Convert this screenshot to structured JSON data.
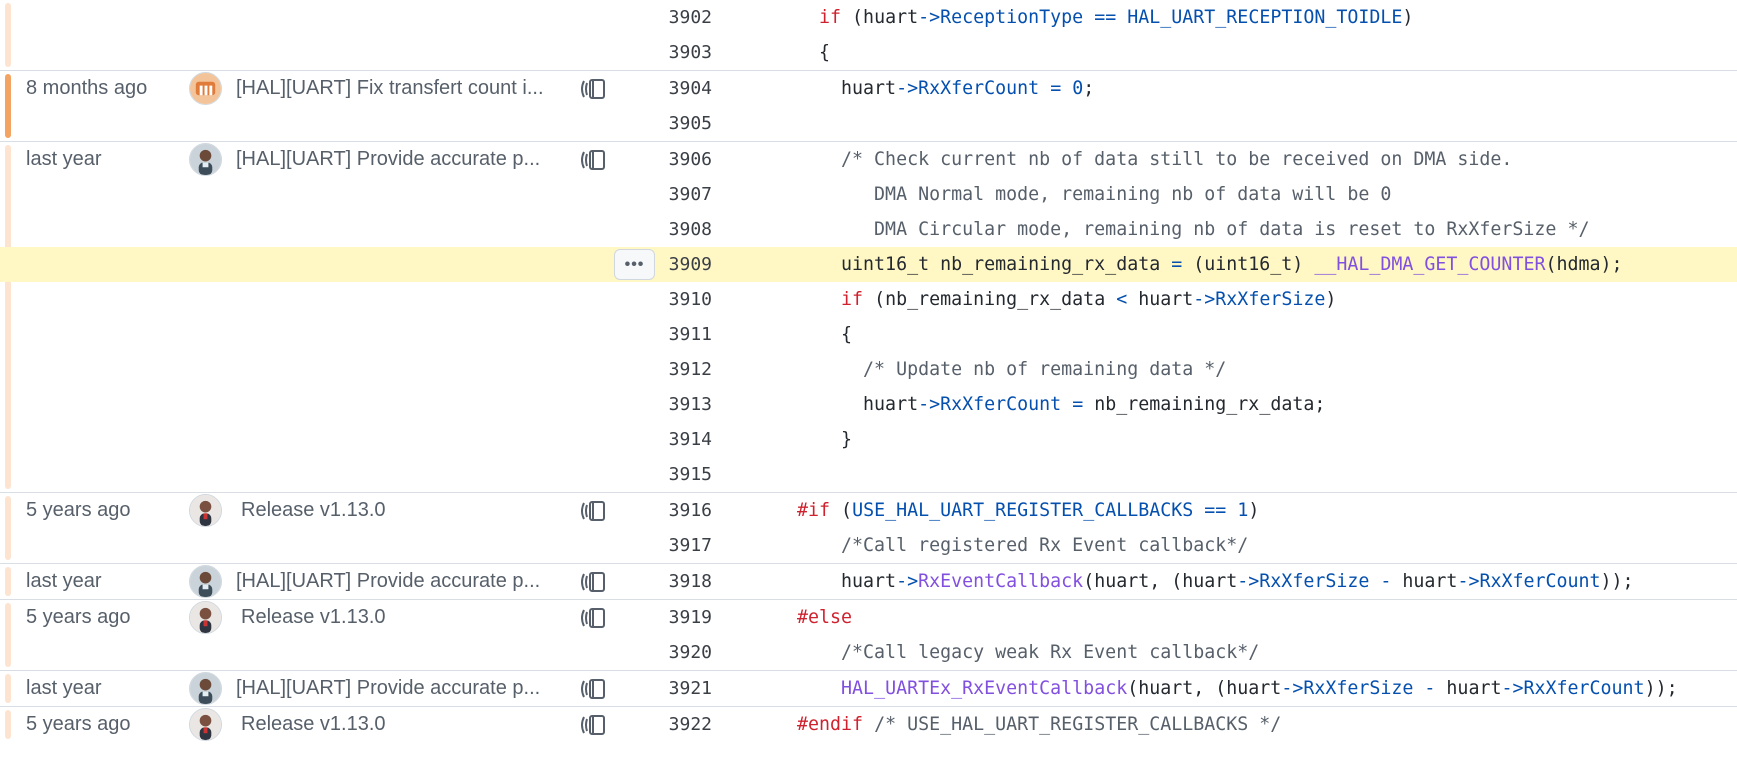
{
  "colors": {
    "heat_recent": "#f4a462",
    "heat_old": "#fde4d1",
    "highlight": "#fff8c5"
  },
  "line_menu": {
    "label": "•••",
    "icon": "kebab-horizontal-icon"
  },
  "hunks": [
    {
      "heat": "old",
      "age": "",
      "message": "",
      "avatar": "none",
      "lines": [
        {
          "num": "3902",
          "code": [
            [
              "",
              "    "
            ],
            [
              "k",
              "if"
            ],
            [
              "",
              " (huart"
            ],
            [
              "p",
              "->"
            ],
            [
              "n",
              "ReceptionType"
            ],
            [
              "",
              " "
            ],
            [
              "p",
              "=="
            ],
            [
              "",
              " "
            ],
            [
              "n",
              "HAL_UART_RECEPTION_TOIDLE"
            ],
            [
              "",
              ")"
            ]
          ]
        },
        {
          "num": "3903",
          "code": [
            [
              "",
              "    {"
            ]
          ]
        }
      ]
    },
    {
      "heat": "recent",
      "age": "8 months ago",
      "message": "[HAL][UART] Fix transfert count i...",
      "avatar": "orange-logo",
      "lines": [
        {
          "num": "3904",
          "code": [
            [
              "",
              "      huart"
            ],
            [
              "p",
              "->"
            ],
            [
              "n",
              "RxXferCount"
            ],
            [
              "",
              " "
            ],
            [
              "p",
              "="
            ],
            [
              "",
              " "
            ],
            [
              "n",
              "0"
            ],
            [
              "",
              ";"
            ]
          ]
        },
        {
          "num": "3905",
          "code": [
            [
              "",
              ""
            ]
          ]
        }
      ]
    },
    {
      "heat": "old",
      "age": "last year",
      "message": "[HAL][UART] Provide accurate p...",
      "avatar": "person-a",
      "lines": [
        {
          "num": "3906",
          "code": [
            [
              "c",
              "      /* Check current nb of data still to be received on DMA side."
            ]
          ]
        },
        {
          "num": "3907",
          "code": [
            [
              "c",
              "         DMA Normal mode, remaining nb of data will be 0"
            ]
          ]
        },
        {
          "num": "3908",
          "code": [
            [
              "c",
              "         DMA Circular mode, remaining nb of data is reset to RxXferSize */"
            ]
          ]
        },
        {
          "num": "3909",
          "highlight": true,
          "code": [
            [
              "",
              "      uint16_t nb_remaining_rx_data "
            ],
            [
              "p",
              "="
            ],
            [
              "",
              " (uint16_t) "
            ],
            [
              "f",
              "__HAL_DMA_GET_COUNTER"
            ],
            [
              "",
              "(hdma);"
            ]
          ]
        },
        {
          "num": "3910",
          "code": [
            [
              "",
              "      "
            ],
            [
              "k",
              "if"
            ],
            [
              "",
              " (nb_remaining_rx_data "
            ],
            [
              "p",
              "<"
            ],
            [
              "",
              " huart"
            ],
            [
              "p",
              "->"
            ],
            [
              "n",
              "RxXferSize"
            ],
            [
              "",
              ")"
            ]
          ]
        },
        {
          "num": "3911",
          "code": [
            [
              "",
              "      {"
            ]
          ]
        },
        {
          "num": "3912",
          "code": [
            [
              "c",
              "        /* Update nb of remaining data */"
            ]
          ]
        },
        {
          "num": "3913",
          "code": [
            [
              "",
              "        huart"
            ],
            [
              "p",
              "->"
            ],
            [
              "n",
              "RxXferCount"
            ],
            [
              "",
              " "
            ],
            [
              "p",
              "="
            ],
            [
              "",
              " nb_remaining_rx_data;"
            ]
          ]
        },
        {
          "num": "3914",
          "code": [
            [
              "",
              "      }"
            ]
          ]
        },
        {
          "num": "3915",
          "code": [
            [
              "",
              ""
            ]
          ]
        }
      ]
    },
    {
      "heat": "old",
      "age": "5 years ago",
      "message": "Release v1.13.0",
      "avatar": "person-b",
      "short": true,
      "lines": [
        {
          "num": "3916",
          "code": [
            [
              "",
              "  "
            ],
            [
              "k",
              "#if"
            ],
            [
              "",
              " ("
            ],
            [
              "n",
              "USE_HAL_UART_REGISTER_CALLBACKS"
            ],
            [
              "",
              " "
            ],
            [
              "p",
              "=="
            ],
            [
              "",
              " "
            ],
            [
              "n",
              "1"
            ],
            [
              "",
              ")"
            ]
          ]
        },
        {
          "num": "3917",
          "code": [
            [
              "c",
              "      /*Call registered Rx Event callback*/"
            ]
          ]
        }
      ]
    },
    {
      "heat": "old",
      "age": "last year",
      "message": "[HAL][UART] Provide accurate p...",
      "avatar": "person-a",
      "lines": [
        {
          "num": "3918",
          "code": [
            [
              "",
              "      huart"
            ],
            [
              "p",
              "->"
            ],
            [
              "f",
              "RxEventCallback"
            ],
            [
              "",
              "(huart, (huart"
            ],
            [
              "p",
              "->"
            ],
            [
              "n",
              "RxXferSize"
            ],
            [
              "",
              " "
            ],
            [
              "p",
              "-"
            ],
            [
              "",
              " huart"
            ],
            [
              "p",
              "->"
            ],
            [
              "n",
              "RxXferCount"
            ],
            [
              "",
              "));"
            ]
          ]
        }
      ]
    },
    {
      "heat": "old",
      "age": "5 years ago",
      "message": "Release v1.13.0",
      "avatar": "person-b",
      "short": true,
      "lines": [
        {
          "num": "3919",
          "code": [
            [
              "",
              "  "
            ],
            [
              "k",
              "#else"
            ]
          ]
        },
        {
          "num": "3920",
          "code": [
            [
              "c",
              "      /*Call legacy weak Rx Event callback*/"
            ]
          ]
        }
      ]
    },
    {
      "heat": "old",
      "age": "last year",
      "message": "[HAL][UART] Provide accurate p...",
      "avatar": "person-a",
      "lines": [
        {
          "num": "3921",
          "code": [
            [
              "",
              "      "
            ],
            [
              "f",
              "HAL_UARTEx_RxEventCallback"
            ],
            [
              "",
              "(huart, (huart"
            ],
            [
              "p",
              "->"
            ],
            [
              "n",
              "RxXferSize"
            ],
            [
              "",
              " "
            ],
            [
              "p",
              "-"
            ],
            [
              "",
              " huart"
            ],
            [
              "p",
              "->"
            ],
            [
              "n",
              "RxXferCount"
            ],
            [
              "",
              "));"
            ]
          ]
        }
      ]
    },
    {
      "heat": "old",
      "age": "5 years ago",
      "message": "Release v1.13.0",
      "avatar": "person-b",
      "short": true,
      "lines": [
        {
          "num": "3922",
          "code": [
            [
              "",
              "  "
            ],
            [
              "k",
              "#endif"
            ],
            [
              "",
              " "
            ],
            [
              "c",
              "/* USE_HAL_UART_REGISTER_CALLBACKS */"
            ]
          ]
        }
      ]
    }
  ]
}
